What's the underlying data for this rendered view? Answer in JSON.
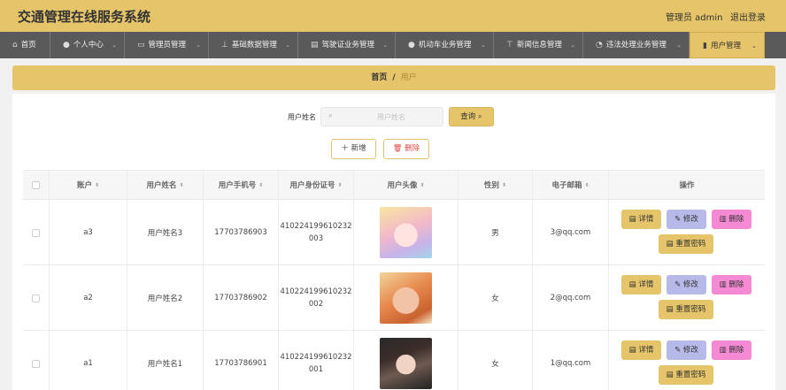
{
  "app": {
    "title": "交通管理在线服务系统",
    "user_label": "管理员 admin",
    "logout_label": "退出登录",
    "accent_color": "#e6c469",
    "nav_bg_color": "#5a5a5a"
  },
  "nav": {
    "items": [
      {
        "label": "首页",
        "icon": "home-icon",
        "has_chevron": false
      },
      {
        "label": "个人中心",
        "icon": "user-icon",
        "has_chevron": true
      },
      {
        "label": "管理员管理",
        "icon": "briefcase-icon",
        "has_chevron": true
      },
      {
        "label": "基础数据管理",
        "icon": "pin-icon",
        "has_chevron": true
      },
      {
        "label": "驾驶证业务管理",
        "icon": "document-icon",
        "has_chevron": true
      },
      {
        "label": "机动车业务管理",
        "icon": "user-icon",
        "has_chevron": true
      },
      {
        "label": "新闻信息管理",
        "icon": "pin-icon",
        "has_chevron": true
      },
      {
        "label": "违法处理业务管理",
        "icon": "clock-icon",
        "has_chevron": true
      },
      {
        "label": "用户管理",
        "icon": "chart-icon",
        "has_chevron": true,
        "active": true
      }
    ]
  },
  "breadcrumb": {
    "home": "首页",
    "separator": "/",
    "current": "用户"
  },
  "search": {
    "label": "用户姓名",
    "placeholder": "用户姓名",
    "value": "",
    "button_label": "查询"
  },
  "actions": {
    "add_label": "新增",
    "delete_label": "删除"
  },
  "table": {
    "columns": [
      "账户",
      "用户姓名",
      "用户手机号",
      "用户身份证号",
      "用户头像",
      "性别",
      "电子邮箱",
      "操作"
    ],
    "rows": [
      {
        "account": "a3",
        "name": "用户姓名3",
        "phone": "17703786903",
        "id_line1": "410224199610232",
        "id_line2": "003",
        "avatar": "avatar-anime-girl",
        "gender": "男",
        "email": "3@qq.com"
      },
      {
        "account": "a2",
        "name": "用户姓名2",
        "phone": "17703786902",
        "id_line1": "410224199610232",
        "id_line2": "002",
        "avatar": "avatar-woman-orange",
        "gender": "女",
        "email": "2@qq.com"
      },
      {
        "account": "a1",
        "name": "用户姓名1",
        "phone": "17703786901",
        "id_line1": "410224199610232",
        "id_line2": "001",
        "avatar": "avatar-woman-dark",
        "gender": "女",
        "email": "1@qq.com"
      }
    ],
    "row_actions": {
      "detail": "详情",
      "edit": "修改",
      "delete": "删除",
      "reset": "重置密码"
    }
  }
}
